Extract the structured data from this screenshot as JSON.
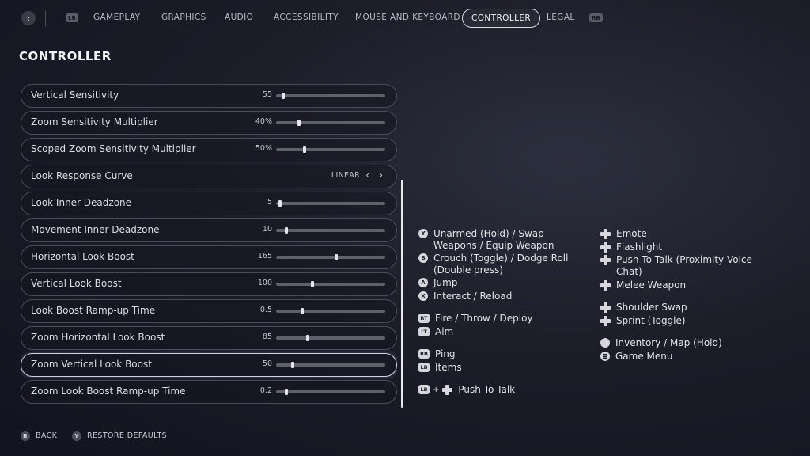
{
  "topbar": {
    "lb": "LB",
    "rb": "RB",
    "tabs": [
      {
        "label": "GAMEPLAY"
      },
      {
        "label": "GRAPHICS"
      },
      {
        "label": "AUDIO"
      },
      {
        "label": "ACCESSIBILITY"
      },
      {
        "label": "MOUSE AND KEYBOARD"
      },
      {
        "label": "CONTROLLER",
        "active": true
      },
      {
        "label": "LEGAL"
      }
    ]
  },
  "page_title": "CONTROLLER",
  "settings": [
    {
      "label": "Vertical Sensitivity",
      "value": "55",
      "level": 0.05
    },
    {
      "label": "Zoom Sensitivity Multiplier",
      "value": "40%",
      "level": 0.2
    },
    {
      "label": "Scoped Zoom Sensitivity Multiplier",
      "value": "50%",
      "level": 0.25
    },
    {
      "label": "Look Response Curve",
      "value": "LINEAR"
    },
    {
      "label": "Look Inner Deadzone",
      "value": "5",
      "level": 0.02
    },
    {
      "label": "Movement Inner Deadzone",
      "value": "10",
      "level": 0.08
    },
    {
      "label": "Horizontal Look Boost",
      "value": "165",
      "level": 0.55
    },
    {
      "label": "Vertical Look Boost",
      "value": "100",
      "level": 0.33
    },
    {
      "label": "Look Boost Ramp-up Time",
      "value": "0.5",
      "level": 0.23
    },
    {
      "label": "Zoom Horizontal Look Boost",
      "value": "85",
      "level": 0.28
    },
    {
      "label": "Zoom Vertical Look Boost",
      "value": "50",
      "level": 0.14
    },
    {
      "label": "Zoom Look Boost Ramp-up Time",
      "value": "0.2",
      "level": 0.08
    }
  ],
  "bindings_left": [
    {
      "glyph": "Y",
      "text": "Unarmed (Hold) / Swap Weapons / Equip Weapon"
    },
    {
      "glyph": "B",
      "text": "Crouch (Toggle) / Dodge Roll (Double press)"
    },
    {
      "glyph": "A",
      "text": "Jump"
    },
    {
      "glyph": "X",
      "text": "Interact / Reload"
    },
    {
      "glyph": "RT",
      "text": "Fire / Throw / Deploy"
    },
    {
      "glyph": "LT",
      "text": "Aim"
    },
    {
      "glyph": "RB",
      "text": "Ping"
    },
    {
      "glyph": "LB",
      "text": "Items"
    },
    {
      "glyph": "LB",
      "plus": "+",
      "text": "Push To Talk"
    }
  ],
  "bindings_right": [
    {
      "text": "Emote"
    },
    {
      "text": "Flashlight"
    },
    {
      "text": "Push To Talk (Proximity Voice Chat)"
    },
    {
      "text": "Melee Weapon"
    },
    {
      "text": "Shoulder Swap"
    },
    {
      "text": "Sprint (Toggle)"
    },
    {
      "text": "Inventory / Map (Hold)"
    },
    {
      "text": "Game Menu"
    }
  ],
  "footer": {
    "back_glyph": "B",
    "back": "BACK",
    "restore_glyph": "Y",
    "restore": "RESTORE DEFAULTS"
  }
}
